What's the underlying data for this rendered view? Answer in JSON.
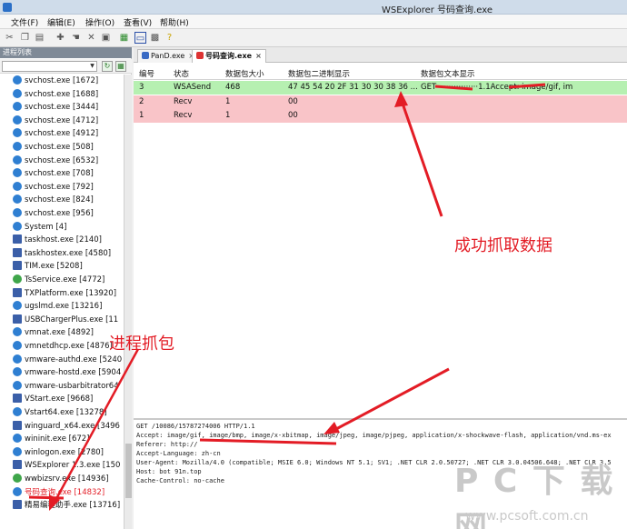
{
  "titlebar": {
    "title": "WSExplorer   号码查询.exe"
  },
  "menu": [
    "文件(F)",
    "编辑(E)",
    "操作(O)",
    "查看(V)",
    "帮助(H)"
  ],
  "left_panel": {
    "header": "进程列表",
    "processes": [
      {
        "label": "svchost.exe [1672]",
        "icon": "process-icon"
      },
      {
        "label": "svchost.exe [1688]",
        "icon": "process-icon"
      },
      {
        "label": "svchost.exe [3444]",
        "icon": "process-icon"
      },
      {
        "label": "svchost.exe [4712]",
        "icon": "process-icon"
      },
      {
        "label": "svchost.exe [4912]",
        "icon": "process-icon"
      },
      {
        "label": "svchost.exe [508]",
        "icon": "process-icon"
      },
      {
        "label": "svchost.exe [6532]",
        "icon": "process-icon"
      },
      {
        "label": "svchost.exe [708]",
        "icon": "process-icon"
      },
      {
        "label": "svchost.exe [792]",
        "icon": "process-icon"
      },
      {
        "label": "svchost.exe [824]",
        "icon": "process-icon"
      },
      {
        "label": "svchost.exe [956]",
        "icon": "process-icon"
      },
      {
        "label": "System [4]",
        "icon": "process-icon"
      },
      {
        "label": "taskhost.exe [2140]",
        "icon": "process-icon"
      },
      {
        "label": "taskhostex.exe [4580]",
        "icon": "process-icon"
      },
      {
        "label": "TIM.exe [5208]",
        "icon": "process-icon"
      },
      {
        "label": "TsService.exe [4772]",
        "icon": "process-icon"
      },
      {
        "label": "TXPlatform.exe [13920]",
        "icon": "process-icon"
      },
      {
        "label": "ugslmd.exe [13216]",
        "icon": "process-icon"
      },
      {
        "label": "USBChargerPlus.exe [11",
        "icon": "process-icon"
      },
      {
        "label": "vmnat.exe [4892]",
        "icon": "process-icon"
      },
      {
        "label": "vmnetdhcp.exe [4876]",
        "icon": "process-icon"
      },
      {
        "label": "vmware-authd.exe [5240",
        "icon": "process-icon"
      },
      {
        "label": "vmware-hostd.exe [5904",
        "icon": "process-icon"
      },
      {
        "label": "vmware-usbarbitrator64",
        "icon": "process-icon"
      },
      {
        "label": "VStart.exe [9668]",
        "icon": "process-icon"
      },
      {
        "label": "Vstart64.exe [13278]",
        "icon": "process-icon"
      },
      {
        "label": "winguard_x64.exe [3496",
        "icon": "process-icon"
      },
      {
        "label": "wininit.exe [672]",
        "icon": "process-icon"
      },
      {
        "label": "winlogon.exe [2780]",
        "icon": "process-icon"
      },
      {
        "label": "WSExplorer 1.3.exe [150",
        "icon": "process-icon"
      },
      {
        "label": "wwbizsrv.exe [14936]",
        "icon": "process-icon"
      },
      {
        "label": "号码查询.exe [14832]",
        "icon": "process-icon"
      },
      {
        "label": "精易编程助手.exe [13716]",
        "icon": "process-icon"
      }
    ]
  },
  "tabs": [
    {
      "label": "PanD.exe",
      "close": "×"
    },
    {
      "label": "号码查询.exe",
      "close": "×"
    }
  ],
  "grid": {
    "columns": [
      "编号",
      "状态",
      "数据包大小",
      "数据包二进制显示",
      "数据包文本显示"
    ],
    "rows": [
      {
        "num": "3",
        "status": "WSASend",
        "size": "468",
        "hex": "47 45 54 20 2F 31 30 30 38 36 ...",
        "text": "GET ················1.1Accept: image/gif, im",
        "bg": "#b6f0b1"
      },
      {
        "num": "2",
        "status": "Recv",
        "size": "1",
        "hex": "00",
        "text": "",
        "bg": "#f9c4c8"
      },
      {
        "num": "1",
        "status": "Recv",
        "size": "1",
        "hex": "00",
        "text": "",
        "bg": "#f9c4c8"
      }
    ]
  },
  "detail": {
    "lines": [
      "GET /10086/15787274006 HTTP/1.1",
      "Accept: image/gif, image/bmp, image/x-xbitmap, image/jpeg, image/pjpeg, application/x-shockwave-flash, application/vnd.ms-ex",
      "Referer: http://",
      "Accept-Language: zh-cn",
      "User-Agent: Mozilla/4.0 (compatible; MSIE 6.0; Windows NT 5.1; SV1; .NET CLR 2.0.50727; .NET CLR 3.0.04506.648; .NET CLR 3.5",
      "Host: bot 91n.top",
      "Cache-Control: no-cache"
    ]
  },
  "annotations": {
    "success_label": "成功抓取数据",
    "process_label": "进程抓包"
  },
  "watermark": {
    "line1": "P C 下 载 网",
    "line2": "www.pcsoft.com.cn"
  },
  "colors": {
    "annotation_red": "#e31c25",
    "send_row": "#b6f0b1",
    "recv_row": "#f9c4c8"
  }
}
